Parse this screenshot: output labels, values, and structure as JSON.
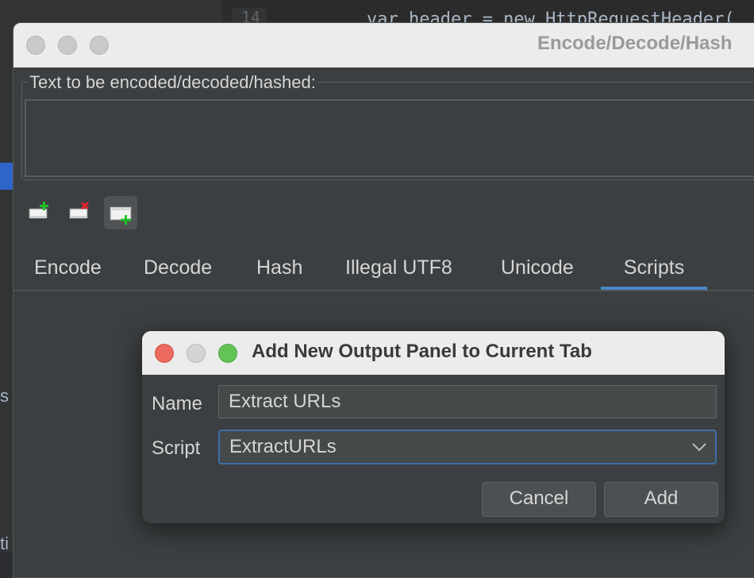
{
  "background": {
    "editor_line_number": "14",
    "editor_code": "var header = new HttpRequestHeader(",
    "left_fragment_1": "s",
    "left_fragment_2": "ti"
  },
  "window": {
    "title": "Encode/Decode/Hash",
    "text_group_label": "Text to be encoded/decoded/hashed:",
    "text_value": "",
    "icons": [
      {
        "name": "add-output-tab-icon"
      },
      {
        "name": "remove-output-tab-icon"
      },
      {
        "name": "add-output-panel-icon"
      }
    ],
    "tabs": [
      {
        "label": "Encode"
      },
      {
        "label": "Decode"
      },
      {
        "label": "Hash"
      },
      {
        "label": "Illegal UTF8"
      },
      {
        "label": "Unicode"
      },
      {
        "label": "Scripts",
        "selected": true
      }
    ]
  },
  "dialog": {
    "title": "Add New Output Panel to Current Tab",
    "name_label": "Name",
    "name_value": "Extract URLs",
    "script_label": "Script",
    "script_value": "ExtractURLs",
    "cancel_label": "Cancel",
    "add_label": "Add"
  },
  "colors": {
    "accent": "#4a88c7",
    "panel_bg": "#3c3f41",
    "traffic_red": "#ed6a5e",
    "traffic_green": "#61c454"
  }
}
